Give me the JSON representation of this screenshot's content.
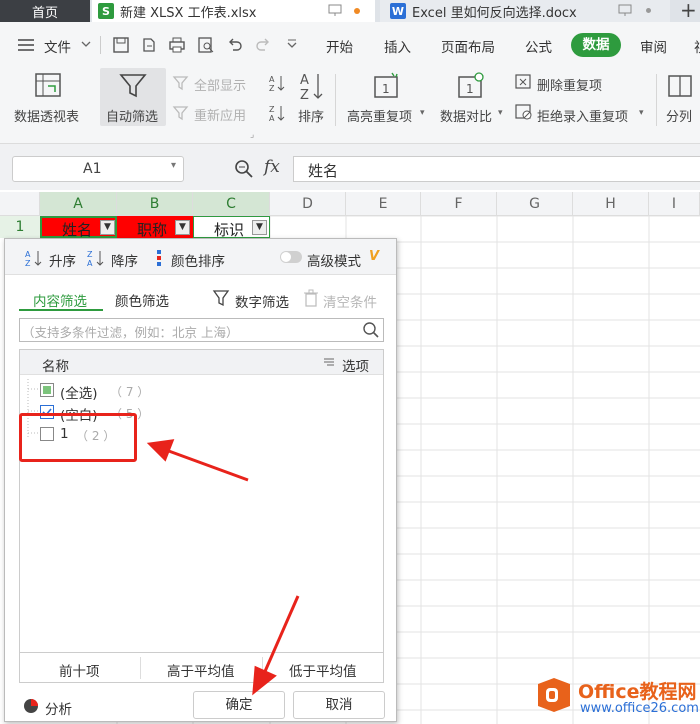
{
  "tabs": {
    "home": "首页",
    "xlsx": "新建 XLSX 工作表.xlsx",
    "docx": "Excel 里如何反向选择.docx",
    "add": "+"
  },
  "menu": {
    "file": "文件",
    "items": [
      "开始",
      "插入",
      "页面布局",
      "公式",
      "数据",
      "审阅",
      "视"
    ],
    "active": "数据"
  },
  "ribbon": {
    "pivot": "数据透视表",
    "autofilter": "自动筛选",
    "show_all": "全部显示",
    "reapply": "重新应用",
    "sort": "排序",
    "highlight_dup": "高亮重复项",
    "compare": "数据对比",
    "delete_dup": "删除重复项",
    "reject_dup": "拒绝录入重复项",
    "split": "分列"
  },
  "formula_bar": {
    "cell_ref": "A1",
    "fx": "fx",
    "value": "姓名"
  },
  "columns": [
    "A",
    "B",
    "C",
    "D",
    "E",
    "F",
    "G",
    "H",
    "I"
  ],
  "row1": {
    "row_number": "1",
    "A": "姓名",
    "B": "职称",
    "C": "标识"
  },
  "filter_panel": {
    "sort_asc": "升序",
    "sort_desc": "降序",
    "color_sort": "颜色排序",
    "advanced": "高级模式",
    "advanced_badge": "V",
    "tab_content": "内容筛选",
    "tab_color": "颜色筛选",
    "number_filter": "数字筛选",
    "clear": "清空条件",
    "search_placeholder": "（支持多条件过滤，例如：北京 上海）",
    "list_header": "名称",
    "options": "选项",
    "items": [
      {
        "label": "(全选)",
        "count": "（ 7 ）",
        "state": "partial"
      },
      {
        "label": "(空白)",
        "count": "（ 5 ）",
        "state": "checked"
      },
      {
        "label": "1",
        "count": "（ 2 ）",
        "state": "unchecked"
      }
    ],
    "top10": "前十项",
    "above_avg": "高于平均值",
    "below_avg": "低于平均值",
    "analysis": "分析",
    "ok": "确定",
    "cancel": "取消"
  },
  "watermark": {
    "brand": "Office教程网",
    "url": "www.office26.com"
  },
  "colors": {
    "accent_green": "#2e9b3e",
    "header_red": "#ff0000",
    "annotation_red": "#e8231b"
  }
}
